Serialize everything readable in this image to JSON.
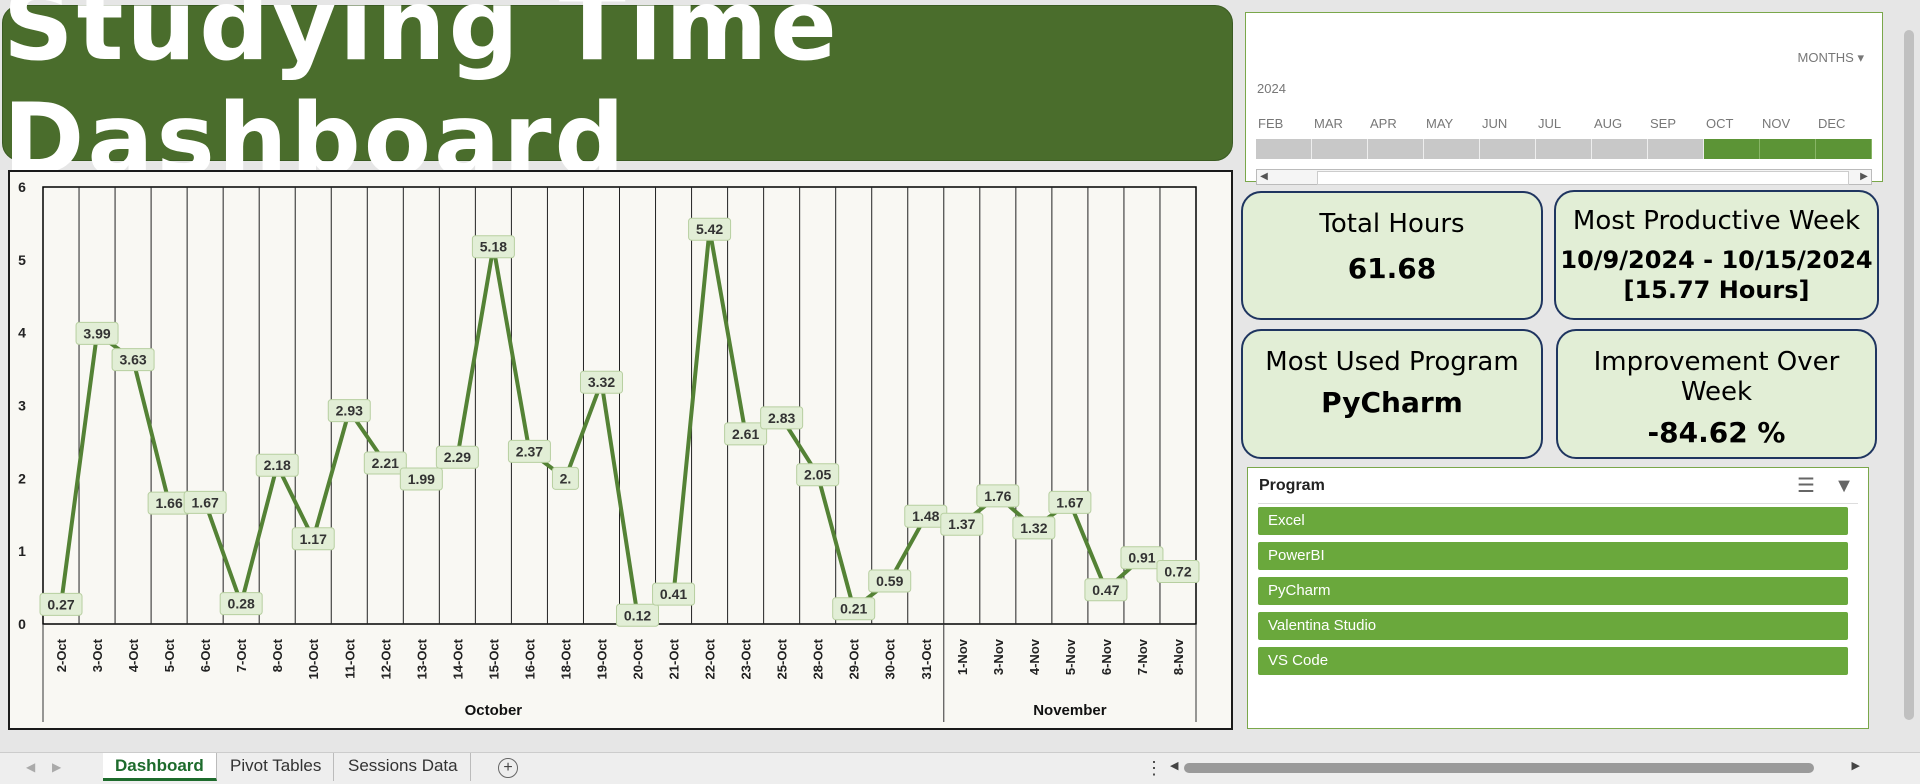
{
  "title": "Studying Time Dashboard",
  "timeline": {
    "period_label": "MONTHS",
    "year": "2024",
    "months": [
      "FEB",
      "MAR",
      "APR",
      "MAY",
      "JUN",
      "JUL",
      "AUG",
      "SEP",
      "OCT",
      "NOV",
      "DEC"
    ],
    "selected": [
      "OCT",
      "NOV",
      "DEC"
    ]
  },
  "kpis": {
    "total_hours": {
      "title": "Total Hours",
      "value": "61.68"
    },
    "productive_week": {
      "title": "Most Productive Week",
      "range": "10/9/2024 - 10/15/2024",
      "hours": "[15.77 Hours]"
    },
    "most_used": {
      "title": "Most Used Program",
      "value": "PyCharm"
    },
    "improvement": {
      "title": "Improvement Over Week",
      "value": "-84.62 %"
    }
  },
  "slicer": {
    "title": "Program",
    "items": [
      "Excel",
      "PowerBI",
      "PyCharm",
      "Valentina Studio",
      "VS Code"
    ]
  },
  "sheets": {
    "tabs": [
      "Dashboard",
      "Pivot Tables",
      "Sessions Data"
    ],
    "active": "Dashboard"
  },
  "colors": {
    "accent": "#4a6d2c",
    "line": "#548235",
    "label_bg": "#e2eed6",
    "selected": "#6aa83c"
  },
  "chart_data": {
    "type": "line",
    "x": [
      "2-Oct",
      "3-Oct",
      "4-Oct",
      "5-Oct",
      "6-Oct",
      "7-Oct",
      "8-Oct",
      "10-Oct",
      "11-Oct",
      "12-Oct",
      "13-Oct",
      "14-Oct",
      "15-Oct",
      "16-Oct",
      "18-Oct",
      "19-Oct",
      "20-Oct",
      "21-Oct",
      "22-Oct",
      "23-Oct",
      "25-Oct",
      "28-Oct",
      "29-Oct",
      "30-Oct",
      "31-Oct",
      "1-Nov",
      "3-Nov",
      "4-Nov",
      "5-Nov",
      "6-Nov",
      "7-Nov",
      "8-Nov"
    ],
    "values": [
      0.27,
      3.99,
      3.63,
      1.66,
      1.67,
      0.28,
      2.18,
      1.17,
      2.93,
      2.21,
      1.99,
      2.29,
      5.18,
      2.37,
      2,
      3.32,
      0.12,
      0.41,
      5.42,
      2.61,
      2.83,
      2.05,
      0.21,
      0.59,
      1.48,
      1.37,
      1.76,
      1.32,
      1.67,
      0.47,
      0.91,
      0.72
    ],
    "data_labels": [
      "0.27",
      "3.99",
      "3.63",
      "1.66",
      "1.67",
      "0.28",
      "2.18",
      "1.17",
      "2.93",
      "2.21",
      "1.99",
      "2.29",
      "5.18",
      "2.37",
      "2.",
      "3.32",
      "0.12",
      "0.41",
      "5.42",
      "2.61",
      "2.83",
      "2.05",
      "0.21",
      "0.59",
      "1.48",
      "1.37",
      "1.76",
      "1.32",
      "1.67",
      "0.47",
      "0.91",
      "0.72"
    ],
    "groups": [
      {
        "name": "October",
        "count": 25
      },
      {
        "name": "November",
        "count": 7
      }
    ],
    "y_ticks": [
      "0",
      "1",
      "2",
      "3",
      "4",
      "5",
      "6"
    ],
    "ylim": [
      0,
      6
    ],
    "grid": "vertical",
    "legend": "none"
  }
}
